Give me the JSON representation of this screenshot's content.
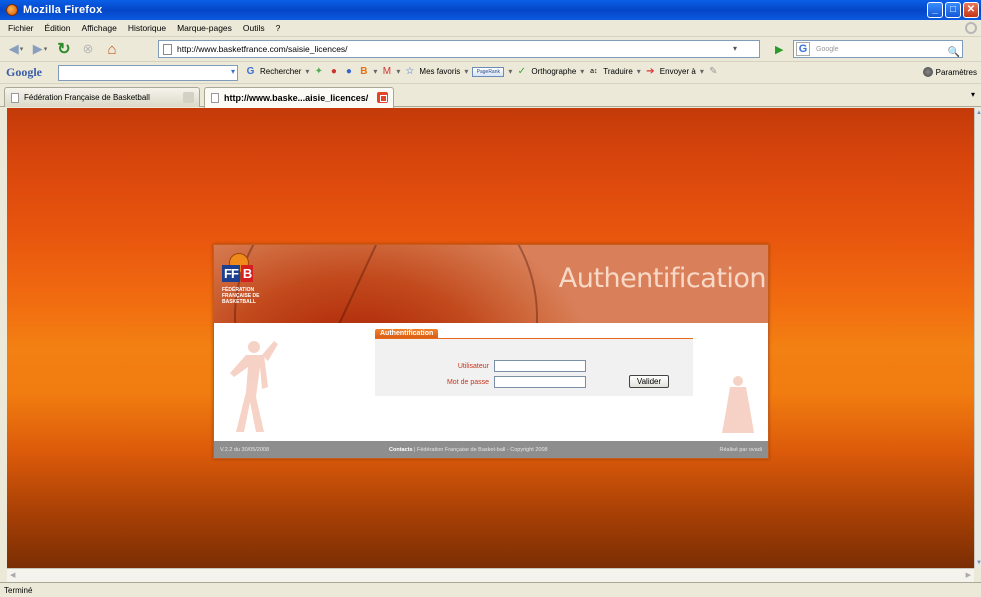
{
  "window": {
    "title": "Mozilla Firefox"
  },
  "menu": {
    "items": [
      "Fichier",
      "Édition",
      "Affichage",
      "Historique",
      "Marque-pages",
      "Outils",
      "?"
    ]
  },
  "navbar": {
    "url": "http://www.basketfrance.com/saisie_licences/",
    "search_placeholder": "Google"
  },
  "google_toolbar": {
    "logo": "Google",
    "rechercher": "Rechercher",
    "favoris": "Mes favoris",
    "pagerank": "PageRank",
    "orthographe": "Orthographe",
    "traduire": "Traduire",
    "envoyer": "Envoyer à",
    "parametres": "Paramètres"
  },
  "tabs": [
    {
      "label": "Fédération Française de Basketball",
      "active": false
    },
    {
      "label": "http://www.baske...aisie_licences/",
      "active": true
    }
  ],
  "page": {
    "logo_letters": [
      "FF",
      "B"
    ],
    "logo_sub": "FÉDÉRATION FRANÇAISE DE BASKETBALL",
    "header_title": "Authentification",
    "form_tab": "Authentification",
    "user_label": "Utilisateur",
    "user_value": "",
    "password_label": "Mot de passe",
    "password_value": "",
    "submit_label": "Valider",
    "footer_left": "V.2.2 du 30/05/2008",
    "footer_center_bold": "Contacts",
    "footer_center": " | Fédération Française de Basket-ball - Copyright 2008",
    "footer_right": "Réalisé par ovadi"
  },
  "status": {
    "text": "Terminé"
  },
  "colors": {
    "accent": "#e96a1a",
    "label_red": "#c6351a",
    "page_top": "#c43a0a",
    "page_mid": "#f38012",
    "page_bottom": "#7a2e04"
  }
}
